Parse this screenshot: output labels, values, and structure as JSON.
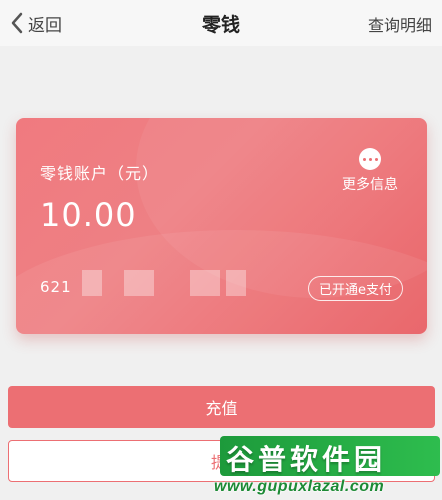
{
  "header": {
    "back_label": "返回",
    "title": "零钱",
    "detail_label": "查询明细"
  },
  "card": {
    "account_title": "零钱账户（元）",
    "balance": "10.00",
    "more_label": "更多信息",
    "card_number_prefix": "621",
    "epay_status": "已开通e支付",
    "card_color": "#ec6f73"
  },
  "actions": {
    "recharge_label": "充值",
    "withdraw_label": "提"
  },
  "watermark": {
    "text": "谷普软件园",
    "url": "www.gupuxlazal.com"
  }
}
